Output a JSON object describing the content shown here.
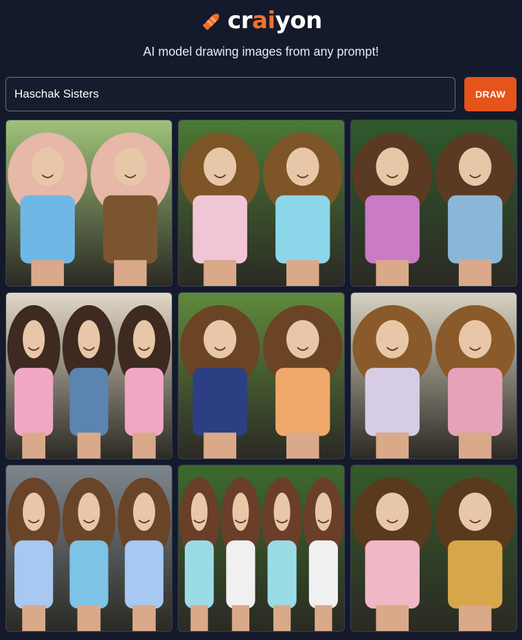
{
  "header": {
    "logo_prefix": "cr",
    "logo_accent": "ai",
    "logo_suffix": "yon",
    "tagline": "AI model drawing images from any prompt!",
    "accent_color": "#f3702a"
  },
  "prompt": {
    "value": "Haschak Sisters",
    "draw_label": "DRAW",
    "button_color": "#e5541b"
  },
  "results": {
    "images": [
      {
        "icon": "generated-image",
        "palette": [
          "#9fc27a",
          "#6fb8e6",
          "#7a5530",
          "#e7b7a7"
        ]
      },
      {
        "icon": "generated-image",
        "palette": [
          "#4a7a35",
          "#f0c6d6",
          "#8cd6ea",
          "#7d5526"
        ]
      },
      {
        "icon": "generated-image",
        "palette": [
          "#2f5a2c",
          "#c97cc4",
          "#8ab7d8",
          "#5a3a22"
        ]
      },
      {
        "icon": "generated-image",
        "palette": [
          "#e2d8c7",
          "#f0a7c4",
          "#5c84b0",
          "#3e2a20"
        ]
      },
      {
        "icon": "generated-image",
        "palette": [
          "#5f8a3b",
          "#2c3f83",
          "#f0a86b",
          "#6a4425"
        ]
      },
      {
        "icon": "generated-image",
        "palette": [
          "#d8d2c2",
          "#d6cce6",
          "#e6a2b8",
          "#8a5a2a"
        ]
      },
      {
        "icon": "generated-image",
        "palette": [
          "#7d868d",
          "#a7c8f0",
          "#7cc3e6",
          "#6a4428"
        ]
      },
      {
        "icon": "generated-image",
        "palette": [
          "#3d6a2c",
          "#9bdbe6",
          "#f0f0f0",
          "#6b3e2a"
        ]
      },
      {
        "icon": "generated-image",
        "palette": [
          "#355a2a",
          "#f0b8c6",
          "#d6a64a",
          "#5a3a1c"
        ]
      }
    ]
  }
}
